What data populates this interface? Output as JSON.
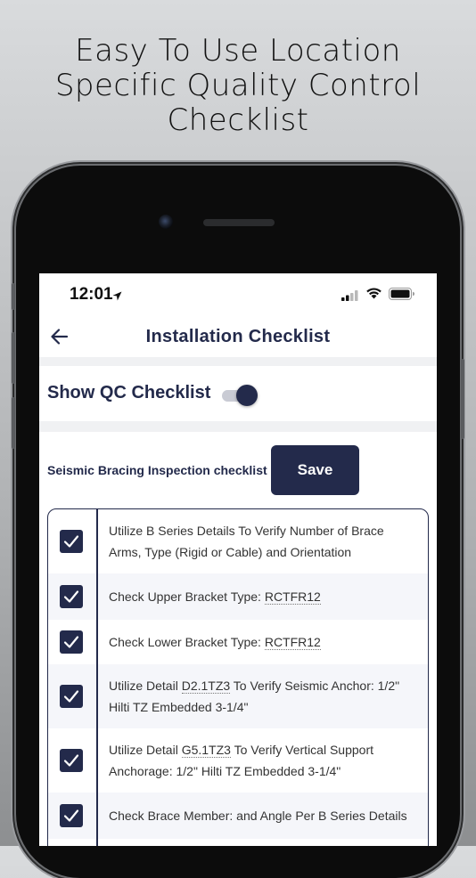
{
  "headline": {
    "line1": "Easy To Use Location",
    "line2": "Specific Quality Control",
    "line3": "Checklist"
  },
  "status_bar": {
    "time": "12:01"
  },
  "nav": {
    "title": "Installation Checklist",
    "back_icon": "arrow-left-icon"
  },
  "qc_toggle": {
    "label": "Show QC Checklist",
    "on": true
  },
  "inspection": {
    "label": "Seismic Bracing Inspection checklist",
    "save_label": "Save"
  },
  "checklist": [
    {
      "checked": true,
      "pre": "Utilize B Series Details To Verify Number of Brace Arms, Type (Rigid or Cable) and Orientation",
      "link": "",
      "post": ""
    },
    {
      "checked": true,
      "pre": "Check Upper Bracket Type: ",
      "link": "RCTFR12",
      "post": ""
    },
    {
      "checked": true,
      "pre": "Check Lower Bracket Type: ",
      "link": "RCTFR12",
      "post": ""
    },
    {
      "checked": true,
      "pre": "Utilize Detail ",
      "link": "D2.1TZ3",
      "post": " To Verify Seismic Anchor: 1/2\" Hilti TZ Embedded 3-1/4\""
    },
    {
      "checked": true,
      "pre": "Utilize Detail ",
      "link": "G5.1TZ3",
      "post": " To Verify Vertical Support Anchorage: 1/2\" Hilti TZ Embedded 3-1/4\""
    },
    {
      "checked": true,
      "pre": "Check Brace Member: and Angle Per B Series Details",
      "link": "",
      "post": ""
    }
  ],
  "colors": {
    "navy": "#232a4b",
    "row_alt": "#f5f6fa"
  }
}
